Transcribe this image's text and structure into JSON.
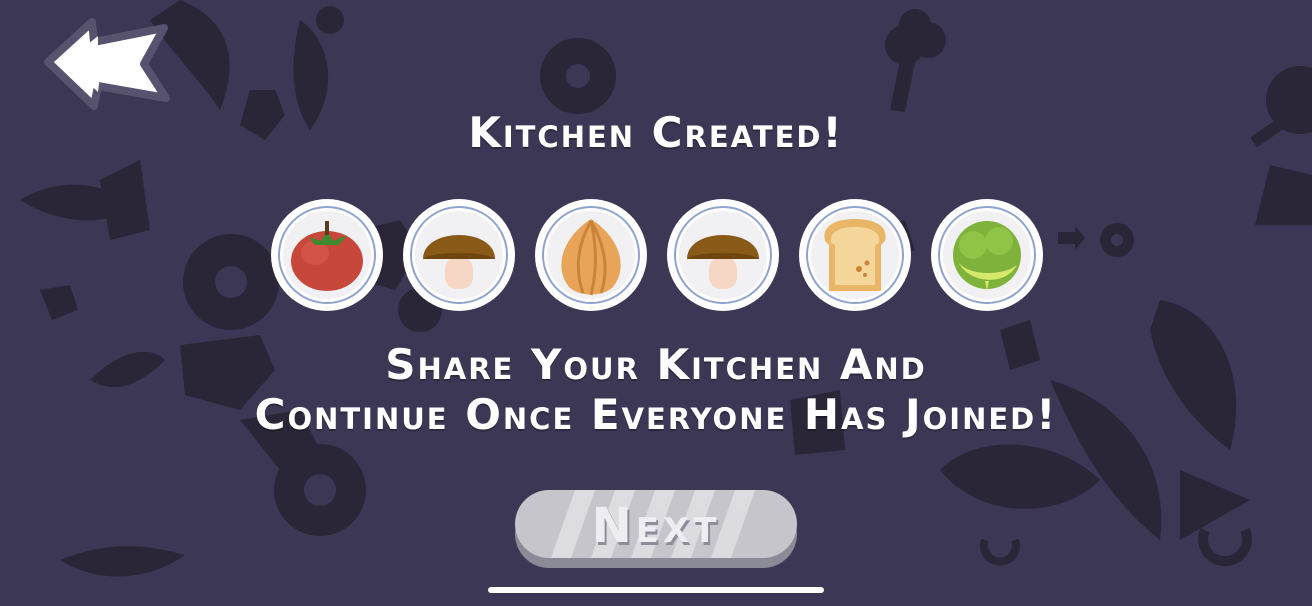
{
  "screen": {
    "title": "Kitchen Created!",
    "message_line1": "Share Your Kitchen And",
    "message_line2": "Continue Once Everyone Has Joined!"
  },
  "back_button": {
    "icon": "back-arrow-icon"
  },
  "kitchen_code": [
    {
      "ingredient": "tomato",
      "icon": "tomato-icon"
    },
    {
      "ingredient": "mushroom",
      "icon": "mushroom-icon"
    },
    {
      "ingredient": "onion",
      "icon": "onion-icon"
    },
    {
      "ingredient": "mushroom",
      "icon": "mushroom-icon"
    },
    {
      "ingredient": "bread",
      "icon": "bread-icon"
    },
    {
      "ingredient": "lettuce",
      "icon": "lettuce-icon"
    }
  ],
  "next_button": {
    "label": "Next",
    "state": "disabled"
  },
  "colors": {
    "background": "#3b3754",
    "silhouette": "#2a2638",
    "text": "#ffffff",
    "plate_rim": "#ffffff",
    "plate_ring": "#8fa3cf",
    "button_disabled": "#c6c5cc"
  }
}
